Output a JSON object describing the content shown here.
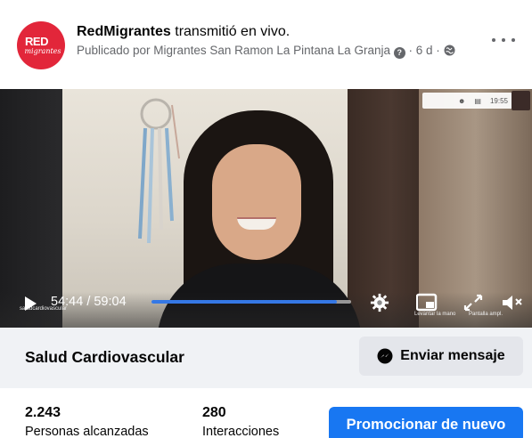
{
  "post": {
    "page_name": "RedMigrantes",
    "action_text": " transmitió en vivo.",
    "published_by": "Publicado por Migrantes San Ramon La Pintana La Granja",
    "time_ago": " · 6 d · ",
    "avatar_line1": "RED",
    "avatar_line2": "migrantes"
  },
  "video": {
    "current_time": "54:44",
    "total_time": "59:04",
    "time_display": "54:44 / 59:04",
    "progress": 0.927,
    "zoom_clock": "19:55",
    "zoom_label": "saludcardiovascular",
    "zoom_btn_raise": "Levantar la mano",
    "zoom_btn_leave": "Pantalla ampl."
  },
  "title_row": {
    "video_title": "Salud Cardiovascular",
    "message_button": "Enviar mensaje"
  },
  "stats": {
    "reach_value": "2.243",
    "reach_label": "Personas alcanzadas",
    "interactions_value": "280",
    "interactions_label": "Interacciones",
    "promote_button": "Promocionar de nuevo"
  },
  "colors": {
    "brand_blue": "#1877f2",
    "avatar_red": "#e2263a",
    "progress_blue": "#3578e5",
    "secondary_text": "#65676b"
  }
}
